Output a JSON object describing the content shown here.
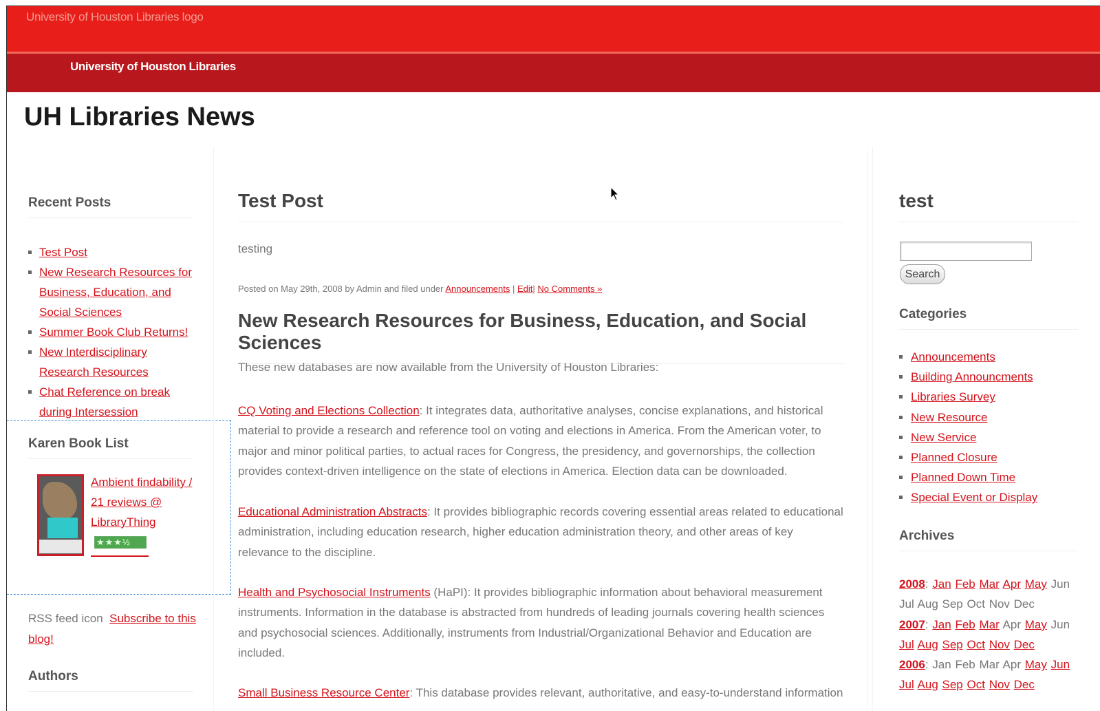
{
  "header": {
    "logo_alt": "University of Houston Libraries logo",
    "nav_title": "University of Houston Libraries",
    "site_title": "UH Libraries News"
  },
  "sidebar_left": {
    "recent_title": "Recent Posts",
    "recent_posts": [
      "Test Post",
      "New Research Resources for Business, Education, and Social Sciences",
      "Summer Book Club Returns!",
      "New Interdisciplinary Research Resources",
      "Chat Reference on break during Intersession"
    ],
    "booklist_title": "Karen Book List",
    "book_link": "Ambient findability / 21 reviews @ LibraryThing",
    "rss_icon_alt": "RSS feed icon",
    "rss_link": "Subscribe to this blog!",
    "authors_title": "Authors"
  },
  "main": {
    "post1": {
      "title": "Test Post",
      "body": "testing",
      "meta_prefix": "Posted on May 29th, 2008 by Admin and filed under",
      "meta_category": "Announcements",
      "meta_sep": "|",
      "meta_edit": "Edit",
      "meta_sep2": "|",
      "meta_comments": "No Comments »"
    },
    "post2": {
      "title": "New Research Resources for Business, Education, and Social Sciences",
      "intro": "These new databases are now available from the University of Houston Libraries:",
      "items": [
        {
          "link": "CQ Voting and Elections Collection",
          "text": ": It integrates data, authoritative analyses, concise explanations, and historical material to provide a research and reference tool on voting and elections in America. From the American voter, to major and minor political parties, to actual races for Congress, the presidency, and governorships, the collection provides context-driven intelligence on the state of elections in America. Election data can be downloaded."
        },
        {
          "link": "Educational Administration Abstracts",
          "text": ": It provides bibliographic records covering essential areas related to educational administration, including education research, higher education administration theory, and other areas of key relevance to the discipline."
        },
        {
          "link": "Health and Psychosocial Instruments",
          "text": " (HaPI): It provides bibliographic information about behavioral measurement instruments. Information in the database is abstracted from hundreds of leading journals covering health sciences and psychosocial sciences. Additionally, instruments from Industrial/Organizational Behavior and Education are included."
        },
        {
          "link": "Small Business Resource Center",
          "text": ": This database provides relevant, authoritative, and easy-to-understand information"
        }
      ]
    }
  },
  "sidebar_right": {
    "title": "test",
    "search_button": "Search",
    "categories_title": "Categories",
    "categories": [
      "Announcements",
      "Building Announcments",
      "Libraries Survey",
      "New Resource",
      "New Service",
      "Planned Closure",
      "Planned Down Time",
      "Special Event or Display"
    ],
    "archives_title": "Archives",
    "archives": [
      {
        "year": "2008",
        "linked": [
          "Jan",
          "Feb",
          "Mar",
          "Apr",
          "May"
        ],
        "plain": [
          "Jun",
          "Jul",
          "Aug",
          "Sep",
          "Oct",
          "Nov",
          "Dec"
        ]
      },
      {
        "year": "2007",
        "linked": [
          "Jan",
          "Feb",
          "Mar"
        ],
        "plain": [
          "Apr"
        ],
        "linked2": [
          "May"
        ],
        "plain2": [
          "Jun"
        ],
        "linked3": [
          "Jul",
          "Aug",
          "Sep",
          "Oct",
          "Nov",
          "Dec"
        ]
      },
      {
        "year": "2006",
        "plain": [
          "Jan",
          "Feb",
          "Mar",
          "Apr"
        ],
        "linked": [
          "May",
          "Jun",
          "Jul",
          "Aug",
          "Sep",
          "Oct",
          "Nov",
          "Dec"
        ]
      }
    ]
  },
  "colors": {
    "logo_bar": "#e81e1a",
    "nav_bar": "#b8181d",
    "link": "#d4141c"
  }
}
